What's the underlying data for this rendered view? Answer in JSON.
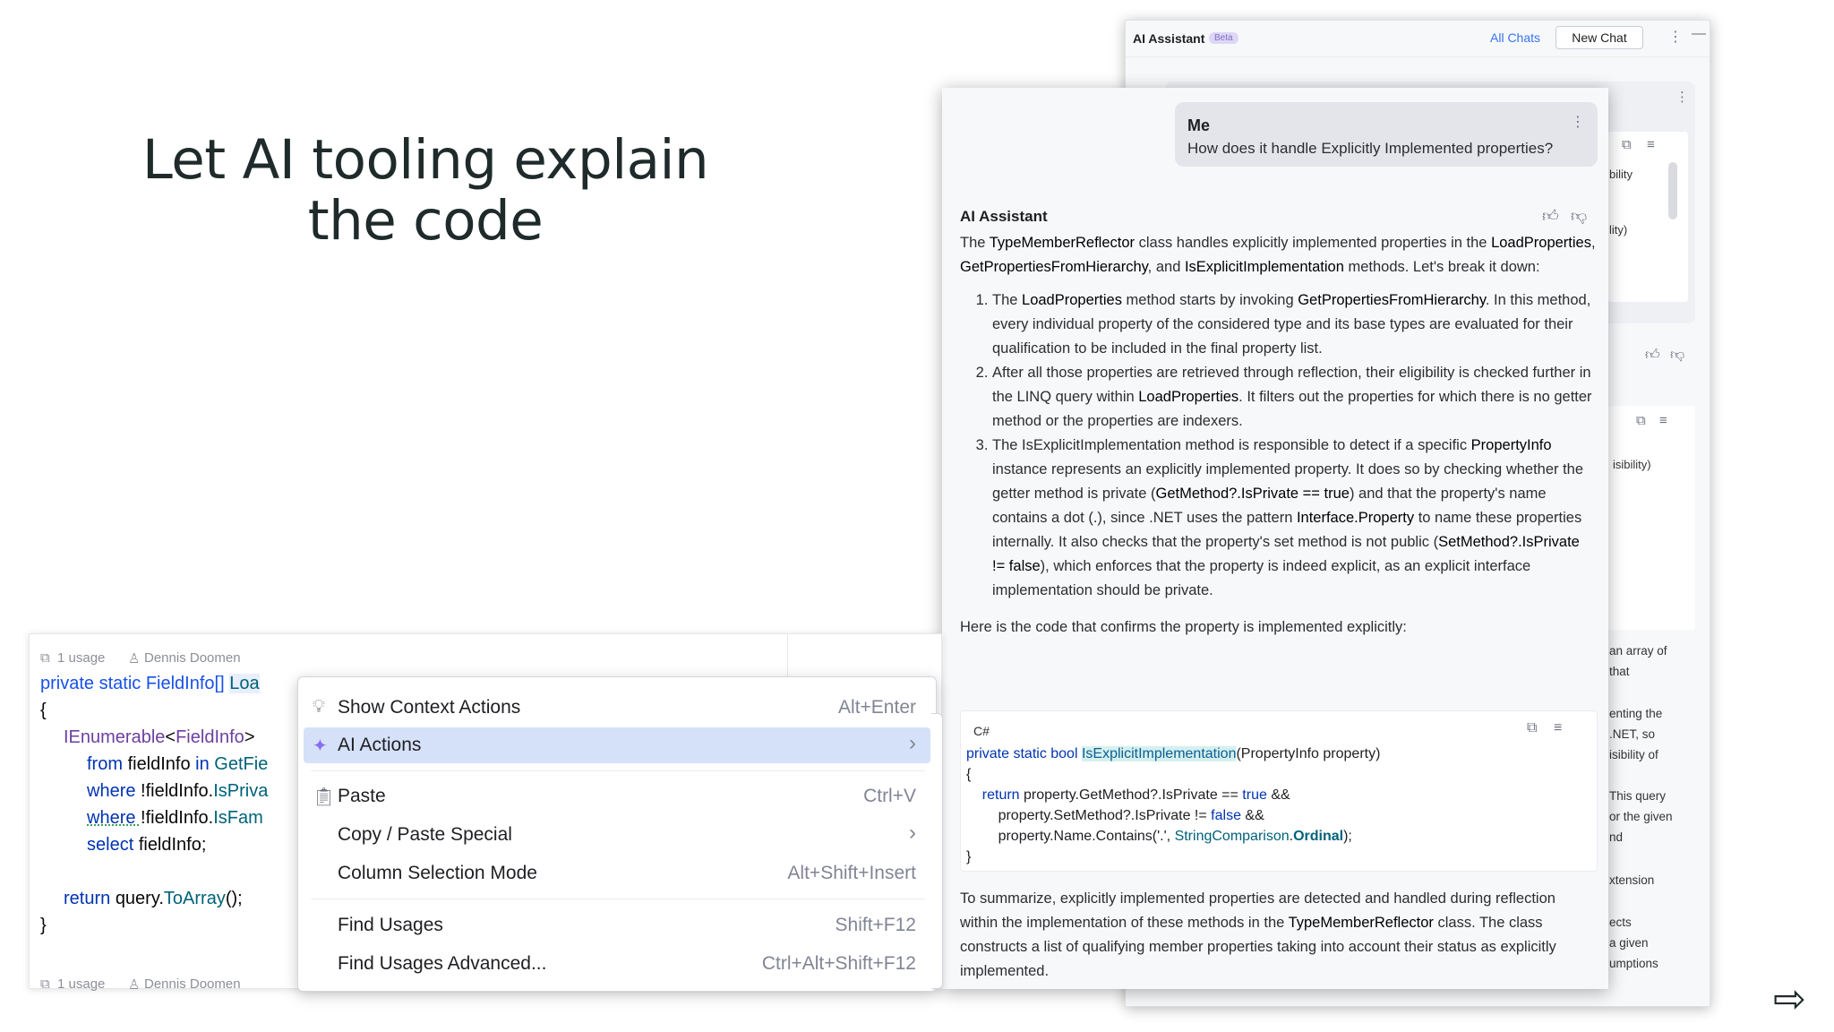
{
  "slide": {
    "title_line1": "Let AI tooling explain",
    "title_line2": "the code",
    "next_arrow": "⇨"
  },
  "back_panel": {
    "title": "AI Assistant",
    "badge": "Beta",
    "all_chats": "All Chats",
    "new_chat": "New Chat",
    "more": "⋮",
    "minimize": "—",
    "fragments": [
      "bility",
      "lity)",
      "isibility)",
      "an array of",
      "that",
      "enting the",
      ".NET, so",
      "isibility of",
      "This query",
      "or the given",
      "nd",
      "xtension",
      "ects",
      "a given",
      "umptions"
    ]
  },
  "chat": {
    "me_name": "Me",
    "me_question": "How does it handle Explicitly Implemented properties?",
    "ai_name": "AI Assistant",
    "intro": {
      "t1": "The ",
      "b1": "TypeMemberReflector",
      "t2": " class handles explicitly implemented properties in the ",
      "b2": "LoadProperties",
      "t3": ", ",
      "b3": "GetPropertiesFromHierarchy",
      "t4": ", and ",
      "b4": "IsExplicitImplementation",
      "t5": " methods. Let's break it down:"
    },
    "items": [
      {
        "t1": "The ",
        "b1": "LoadProperties",
        "t2": " method starts by invoking ",
        "b2": "GetPropertiesFromHierarchy",
        "t3": ". In this method, every individual property of the considered type and its base types are evaluated for their qualification to be included in the final property list."
      },
      {
        "t1": "After all those properties are retrieved through reflection, their eligibility is checked further in the LINQ query within ",
        "b1": "LoadProperties",
        "t2": ". It filters out the properties for which there is no getter method or the properties are indexers."
      },
      {
        "t1": "The IsExplicitImplementation method is responsible to detect if a specific ",
        "b1": "PropertyInfo",
        "t2": " instance represents an explicitly implemented property. It does so by checking whether the getter method is private (",
        "b2": "GetMethod?.IsPrivate == true",
        "t3": ") and that the property's name contains a dot (.), since .NET uses the pattern ",
        "b3": "Interface.Property",
        "t4": " to name these properties internally. It also checks that the property's set method is not public (",
        "b4": "SetMethod?.IsPrivate != false",
        "t5": "), which enforces that the property is indeed explicit, as an explicit interface implementation should be private."
      }
    ],
    "code_intro": "Here is the code that confirms the property is implemented explicitly:",
    "code": {
      "lang": "C#",
      "l1_kw": "private static bool ",
      "l1_name": "IsExplicitImplementation",
      "l1_rest": "(PropertyInfo property)",
      "l2": "{",
      "l3_kw": "return",
      "l3_a": " property.GetMethod?.IsPrivate == ",
      "l3_true": "true",
      "l3_b": " &&",
      "l4_a": "property.SetMethod?.IsPrivate != ",
      "l4_false": "false",
      "l4_b": " &&",
      "l5_a": "property.Name.Contains('.', ",
      "l5_type": "StringComparison",
      "l5_dot": ".",
      "l5_member": "Ordinal",
      "l5_b": ");",
      "l6": "}"
    },
    "summary": {
      "t1": "To summarize, explicitly implemented properties are detected and handled during reflection within the implementation of these methods in the ",
      "b1": "TypeMemberReflector",
      "t2": " class. The class constructs a list of qualifying member properties taking into account their status as explicitly implemented."
    }
  },
  "editor": {
    "usage": "1 usage",
    "author": "Dennis Doomen",
    "line1_a": "private static ",
    "line1_b": "FieldInfo",
    "line1_c": "[] ",
    "line1_d": "Loa",
    "line2": "{",
    "line3_a": "IEnumerable",
    "line3_b": "<",
    "line3_c": "FieldInfo",
    "line3_d": ">",
    "line4_a": "from ",
    "line4_b": "fieldInfo ",
    "line4_c": "in ",
    "line4_d": "GetFie",
    "line5_a": "where ",
    "line5_b": "!fieldInfo.",
    "line5_c": "IsPriva",
    "line6_a": "where ",
    "line6_b": "!fieldInfo.",
    "line6_c": "IsFam",
    "line7_a": "select ",
    "line7_b": "fieldInfo;",
    "line9_a": "return ",
    "line9_b": "query.",
    "line9_c": "ToArray",
    "line9_d": "();",
    "line10": "}"
  },
  "menu": {
    "items": [
      {
        "label": "Show Context Actions",
        "shortcut": "Alt+Enter",
        "icon": "bulb-icon"
      },
      {
        "label": "AI Actions",
        "shortcut": "›",
        "icon": "sparkle-icon"
      },
      {
        "label": "Paste",
        "shortcut": "Ctrl+V",
        "icon": "clipboard-icon"
      },
      {
        "label": "Copy / Paste Special",
        "shortcut": "›"
      },
      {
        "label": "Column Selection Mode",
        "shortcut": "Alt+Shift+Insert"
      },
      {
        "label": "Find Usages",
        "shortcut": "Shift+F12"
      },
      {
        "label": "Find Usages Advanced...",
        "shortcut": "Ctrl+Alt+Shift+F12"
      }
    ]
  },
  "colors": {
    "accent": "#3574f0",
    "selection": "#d5e1f9",
    "highlight": "#d4f0ee"
  }
}
